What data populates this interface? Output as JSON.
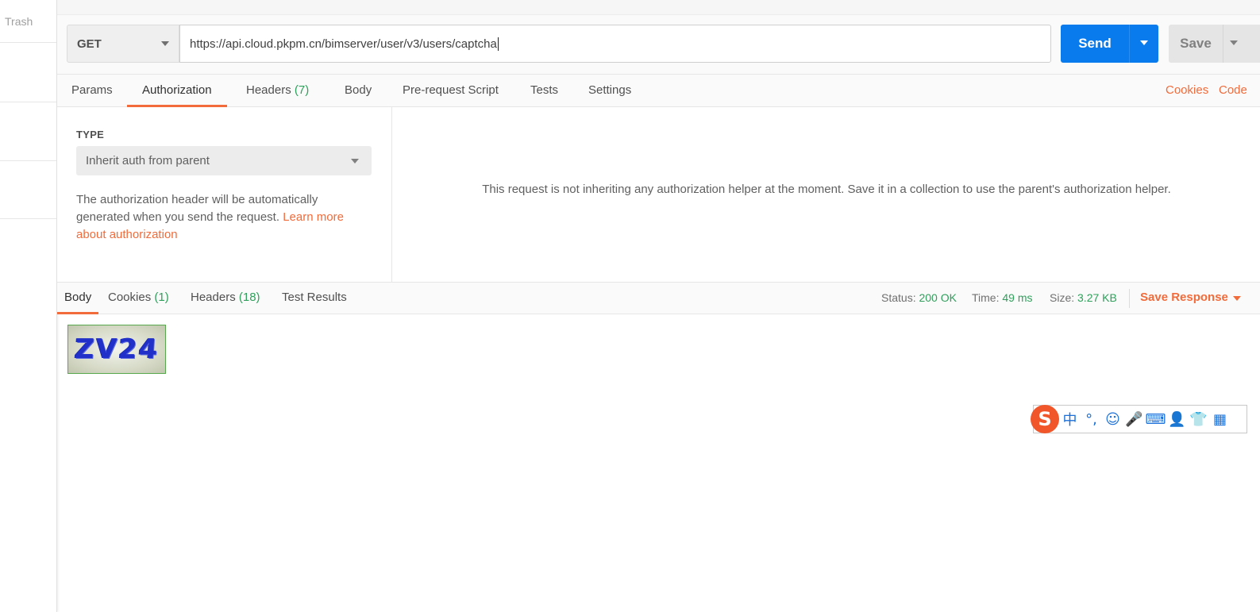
{
  "sidebar": {
    "trash_label": "Trash"
  },
  "request": {
    "method": "GET",
    "url": "https://api.cloud.pkpm.cn/bimserver/user/v3/users/captcha",
    "send_label": "Send",
    "save_label": "Save"
  },
  "request_tabs": [
    {
      "label": "Params",
      "count": ""
    },
    {
      "label": "Authorization",
      "count": ""
    },
    {
      "label": "Headers",
      "count": "(7)"
    },
    {
      "label": "Body",
      "count": ""
    },
    {
      "label": "Pre-request Script",
      "count": ""
    },
    {
      "label": "Tests",
      "count": ""
    },
    {
      "label": "Settings",
      "count": ""
    }
  ],
  "active_request_tab": "Authorization",
  "right_links": {
    "cookies": "Cookies",
    "code": "Code"
  },
  "auth": {
    "type_label": "TYPE",
    "type_value": "Inherit auth from parent",
    "description": "The authorization header will be automatically generated when you send the request.",
    "learn_more": "Learn more about authorization",
    "message": "This request is not inheriting any authorization helper at the moment. Save it in a collection to use the parent's authorization helper."
  },
  "response_tabs": [
    {
      "label": "Body",
      "count": ""
    },
    {
      "label": "Cookies",
      "count": "(1)"
    },
    {
      "label": "Headers",
      "count": "(18)"
    },
    {
      "label": "Test Results",
      "count": ""
    }
  ],
  "active_response_tab": "Body",
  "status": {
    "status_label": "Status:",
    "status_value": "200 OK",
    "time_label": "Time:",
    "time_value": "49 ms",
    "size_label": "Size:",
    "size_value": "3.27 KB",
    "save_response": "Save Response"
  },
  "response_body": {
    "captcha_text": "ZV24"
  },
  "ime": {
    "logo": "S",
    "items": [
      "中",
      "°,",
      "☺",
      "🎤",
      "⌨",
      "👤",
      "👕",
      "▦"
    ]
  },
  "colors": {
    "accent": "#f26b3a",
    "primary": "#097bed",
    "success": "#2fa05b"
  }
}
